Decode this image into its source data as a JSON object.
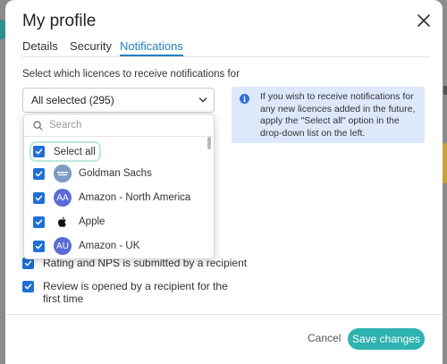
{
  "modal": {
    "title": "My profile"
  },
  "tabs": [
    {
      "label": "Details"
    },
    {
      "label": "Security"
    },
    {
      "label": "Notifications"
    }
  ],
  "active_tab": "Notifications",
  "licences": {
    "prompt": "Select which licences to receive notifications for",
    "selected_value": "All selected (295)"
  },
  "info": {
    "text": "If you wish to receive notifications for any new licences added in the future, apply the \"Select all\" option in the drop-down list on the left."
  },
  "dropdown": {
    "search_placeholder": "Search",
    "select_all_label": "Select all",
    "options": [
      {
        "label": "Goldman Sachs",
        "avatar": "goldman-sachs-logo",
        "checked": true
      },
      {
        "label": "Amazon - North America",
        "avatar_text": "AA",
        "checked": true
      },
      {
        "label": "Apple",
        "avatar": "apple-logo",
        "checked": true
      },
      {
        "label": "Amazon - UK",
        "avatar_text": "AU",
        "checked": true
      }
    ]
  },
  "notifications": [
    {
      "label": "Rating and NPS is submitted by a recipient",
      "checked": true
    },
    {
      "label": "Review is opened by a recipient for the first time",
      "checked": true
    }
  ],
  "footer": {
    "cancel_label": "Cancel",
    "save_label": "Save changes"
  },
  "colors": {
    "accent_blue": "#1f7fc4",
    "checkbox_blue": "#1f6fd6",
    "save_teal": "#2fb3b0",
    "info_bg": "#dde8fb"
  }
}
